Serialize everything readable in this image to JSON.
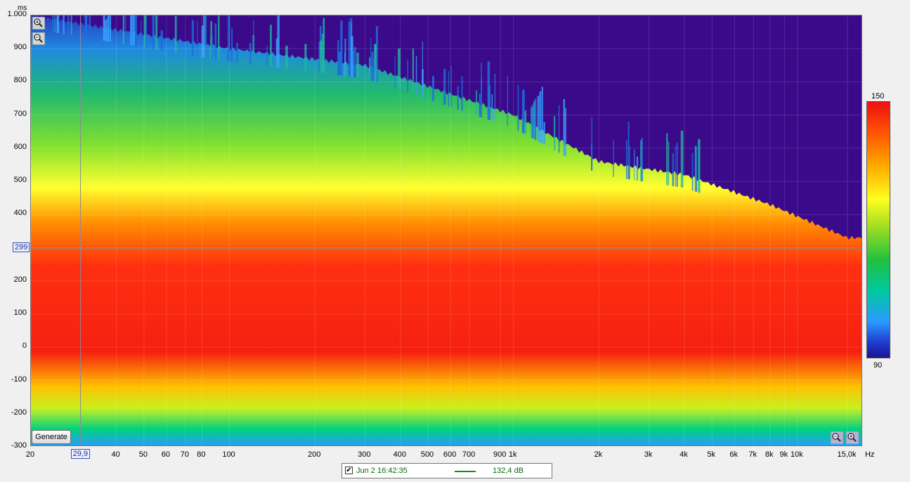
{
  "chart_data": {
    "type": "heatmap",
    "title": "",
    "xlabel": "",
    "ylabel": "",
    "y_unit": "ms",
    "x_unit": "Hz",
    "x_scale": "log",
    "xlim": [
      20,
      17000
    ],
    "ylim": [
      -300,
      1000
    ],
    "y_ticks": [
      {
        "value": 1000,
        "label": "1.000"
      },
      {
        "value": 900,
        "label": "900"
      },
      {
        "value": 800,
        "label": "800"
      },
      {
        "value": 700,
        "label": "700"
      },
      {
        "value": 600,
        "label": "600"
      },
      {
        "value": 500,
        "label": "500"
      },
      {
        "value": 400,
        "label": "400"
      },
      {
        "value": 300,
        "label": "300"
      },
      {
        "value": 200,
        "label": "200"
      },
      {
        "value": 100,
        "label": "100"
      },
      {
        "value": 0,
        "label": "0"
      },
      {
        "value": -100,
        "label": "-100"
      },
      {
        "value": -200,
        "label": "-200"
      },
      {
        "value": -300,
        "label": "-300"
      }
    ],
    "x_ticks": [
      {
        "value": 20,
        "label": "20"
      },
      {
        "value": 40,
        "label": "40"
      },
      {
        "value": 50,
        "label": "50"
      },
      {
        "value": 60,
        "label": "60"
      },
      {
        "value": 70,
        "label": "70"
      },
      {
        "value": 80,
        "label": "80"
      },
      {
        "value": 100,
        "label": "100"
      },
      {
        "value": 200,
        "label": "200"
      },
      {
        "value": 300,
        "label": "300"
      },
      {
        "value": 400,
        "label": "400"
      },
      {
        "value": 500,
        "label": "500"
      },
      {
        "value": 600,
        "label": "600"
      },
      {
        "value": 700,
        "label": "700"
      },
      {
        "value": 900,
        "label": "900"
      },
      {
        "value": 1000,
        "label": "1k"
      },
      {
        "value": 2000,
        "label": "2k"
      },
      {
        "value": 3000,
        "label": "3k"
      },
      {
        "value": 4000,
        "label": "4k"
      },
      {
        "value": 5000,
        "label": "5k"
      },
      {
        "value": 6000,
        "label": "6k"
      },
      {
        "value": 7000,
        "label": "7k"
      },
      {
        "value": 8000,
        "label": "8k"
      },
      {
        "value": 9000,
        "label": "9k"
      },
      {
        "value": 10000,
        "label": "10k"
      },
      {
        "value": 15000,
        "label": "15,0k"
      }
    ],
    "colorbar": {
      "min": 90,
      "max": 150,
      "min_label": "90",
      "max_label": "150"
    },
    "cursor": {
      "x": 29.9,
      "x_label": "29,9",
      "y": 299,
      "y_label": "299"
    },
    "decay_profile_ms": [
      {
        "freq": 20,
        "top": 1000
      },
      {
        "freq": 100,
        "top": 900
      },
      {
        "freq": 300,
        "top": 850
      },
      {
        "freq": 1000,
        "top": 700
      },
      {
        "freq": 2000,
        "top": 560
      },
      {
        "freq": 4000,
        "top": 520
      },
      {
        "freq": 8000,
        "top": 430
      },
      {
        "freq": 15000,
        "top": 330
      }
    ],
    "grid": true,
    "legend_position": "bottom-center"
  },
  "colors": {
    "plot_background": "#3a0a8a",
    "cursor_line": "#8a8aa0"
  },
  "controls": {
    "generate_label": "Generate"
  },
  "legend": {
    "checked": true,
    "name": "Jun 2 16:42:35",
    "value": "132,4 dB",
    "color": "#1a8a1a"
  },
  "icons": {
    "zoom_in": "zoom-in-icon",
    "zoom_out": "zoom-out-icon"
  }
}
